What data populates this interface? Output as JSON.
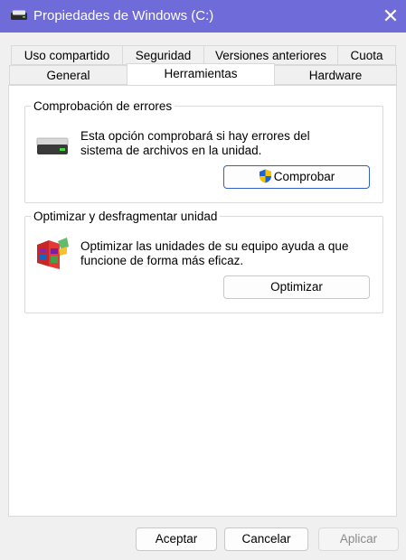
{
  "window": {
    "title": "Propiedades de Windows (C:)",
    "close_glyph": "✕",
    "accent_color": "#6f6bd9"
  },
  "tabs": {
    "row1": [
      "Uso compartido",
      "Seguridad",
      "Versiones anteriores",
      "Cuota"
    ],
    "row2": [
      "General",
      "Herramientas",
      "Hardware"
    ],
    "active": "Herramientas"
  },
  "error_check": {
    "legend": "Comprobación de errores",
    "description_line1": "Esta opción comprobará si hay errores del",
    "description_line2": "sistema de archivos en la unidad.",
    "button_label": "Comprobar",
    "icon": "drive-icon"
  },
  "optimize": {
    "legend": "Optimizar y desfragmentar unidad",
    "description_line1": "Optimizar las unidades de su equipo ayuda a que",
    "description_line2": "funcione de forma más eficaz.",
    "button_label": "Optimizar",
    "icon": "defrag-icon"
  },
  "footer": {
    "ok_label": "Aceptar",
    "cancel_label": "Cancelar",
    "apply_label": "Aplicar"
  }
}
